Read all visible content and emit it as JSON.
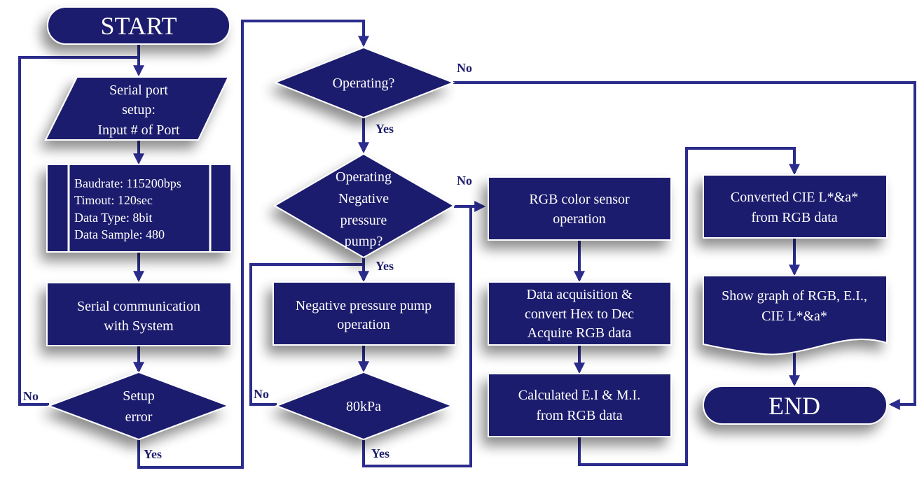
{
  "colors": {
    "shape": "#1e1f6e",
    "line": "#2b2c8c",
    "text": "#ffffff"
  },
  "nodes": {
    "start": "START",
    "serial_setup": [
      "Serial port",
      "setup:",
      "Input # of Port"
    ],
    "config": [
      "Baudrate: 115200bps",
      "Timout: 120sec",
      "Data Type:  8bit",
      "Data Sample:  480"
    ],
    "serial_comm": [
      "Serial communication",
      "with System"
    ],
    "setup_error": [
      "Setup",
      "error"
    ],
    "operating": "Operating?",
    "operating_pump": [
      "Operating",
      "Negative",
      "pressure",
      "pump?"
    ],
    "pump_operation": [
      "Negative pressure pump",
      "operation"
    ],
    "pressure_check": "80kPa",
    "rgb_sensor": [
      "RGB  color sensor",
      "operation"
    ],
    "data_acq": [
      "Data acquisition &",
      "convert Hex  to Dec",
      "Acquire RGB  data"
    ],
    "calc": [
      "Calculated E.I & M.I.",
      "from RGB  data"
    ],
    "convert_cie": [
      "Converted CIE L*&a*",
      "from RGB data"
    ],
    "show_graph": [
      "Show graph of RGB, E.I.,",
      "CIE L*&a*"
    ],
    "end": "END"
  },
  "labels": {
    "yes": "Yes",
    "no": "No"
  }
}
